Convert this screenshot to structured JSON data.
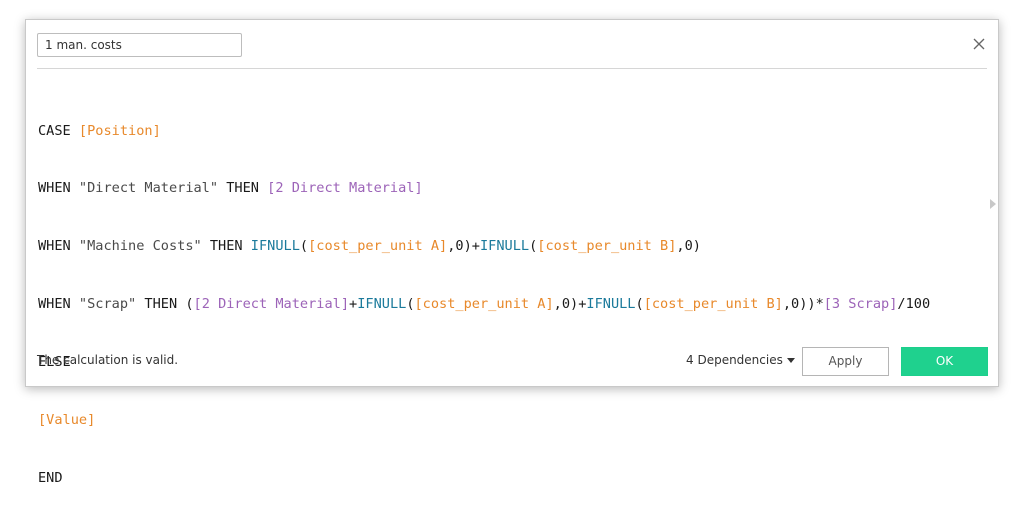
{
  "dialog": {
    "name_value": "1 man. costs",
    "status_text": "The calculation is valid.",
    "dependencies_label": "4 Dependencies",
    "apply_label": "Apply",
    "ok_label": "OK",
    "close_icon": "close-icon"
  },
  "code": {
    "l1": {
      "a": "CASE ",
      "b": "[Position]"
    },
    "l2": {
      "a": "WHEN ",
      "b": "\"Direct Material\"",
      "c": " THEN ",
      "d": "[2 Direct Material]"
    },
    "l3": {
      "a": "WHEN ",
      "b": "\"Machine Costs\"",
      "c": " THEN ",
      "d": "IFNULL",
      "e": "(",
      "f": "[cost_per_unit A]",
      "g": ",0)+",
      "h": "IFNULL",
      "i": "(",
      "j": "[cost_per_unit B]",
      "k": ",0)"
    },
    "l4": {
      "a": "WHEN ",
      "b": "\"Scrap\"",
      "c": " THEN (",
      "d": "[2 Direct Material]",
      "e": "+",
      "f": "IFNULL",
      "g": "(",
      "h": "[cost_per_unit A]",
      "i": ",0)+",
      "j": "IFNULL",
      "k": "(",
      "l": "[cost_per_unit B]",
      "m": ",0))*",
      "n": "[3 Scrap]",
      "o": "/100"
    },
    "l5": {
      "a": "ELSE"
    },
    "l6": {
      "a": "[Value]"
    },
    "l7": {
      "a": "END"
    }
  },
  "colors": {
    "field": "#e8892b",
    "calculated_field": "#9c63b8",
    "function": "#1b7a9b",
    "ok_button": "#1fd18e"
  }
}
